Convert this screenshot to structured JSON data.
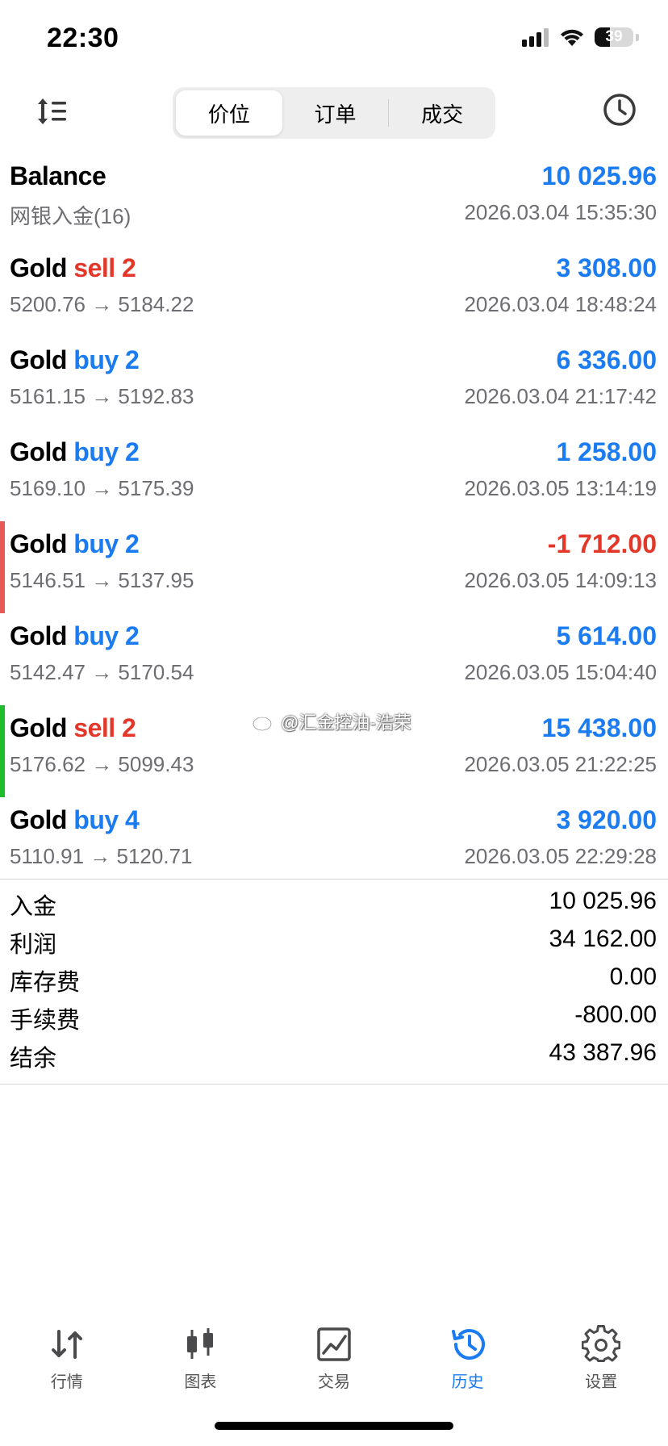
{
  "status": {
    "time": "22:30",
    "battery": "39",
    "battery_level": 0.39
  },
  "toolbar": {
    "segments": [
      {
        "label": "价位",
        "active": true
      },
      {
        "label": "订单",
        "active": false
      },
      {
        "label": "成交",
        "active": false
      }
    ]
  },
  "deals": [
    {
      "title": "Balance",
      "side": "",
      "sub": "网银入金(16)",
      "amount": "10 025.96",
      "amount_color": "#1b7cf2",
      "time": "2026.03.04 15:35:30",
      "indicator": ""
    },
    {
      "title": "Gold",
      "side": "sell 2",
      "side_type": "sell",
      "sub": "5200.76 → 5184.22",
      "amount": "3 308.00",
      "amount_color": "#1b7cf2",
      "time": "2026.03.04 18:48:24",
      "indicator": ""
    },
    {
      "title": "Gold",
      "side": "buy 2",
      "side_type": "buy",
      "sub": "5161.15 → 5192.83",
      "amount": "6 336.00",
      "amount_color": "#1b7cf2",
      "time": "2026.03.04 21:17:42",
      "indicator": ""
    },
    {
      "title": "Gold",
      "side": "buy 2",
      "side_type": "buy",
      "sub": "5169.10 → 5175.39",
      "amount": "1 258.00",
      "amount_color": "#1b7cf2",
      "time": "2026.03.05 13:14:19",
      "indicator": ""
    },
    {
      "title": "Gold",
      "side": "buy 2",
      "side_type": "buy",
      "sub": "5146.51 → 5137.95",
      "amount": "-1 712.00",
      "amount_color": "#e3372a",
      "time": "2026.03.05 14:09:13",
      "indicator": "#e55a55"
    },
    {
      "title": "Gold",
      "side": "buy 2",
      "side_type": "buy",
      "sub": "5142.47 → 5170.54",
      "amount": "5 614.00",
      "amount_color": "#1b7cf2",
      "time": "2026.03.05 15:04:40",
      "indicator": ""
    },
    {
      "title": "Gold",
      "side": "sell 2",
      "side_type": "sell",
      "sub": "5176.62 → 5099.43",
      "amount": "15 438.00",
      "amount_color": "#1b7cf2",
      "time": "2026.03.05 21:22:25",
      "indicator": "#1fbd2e"
    },
    {
      "title": "Gold",
      "side": "buy 4",
      "side_type": "buy",
      "sub": "5110.91 → 5120.71",
      "amount": "3 920.00",
      "amount_color": "#1b7cf2",
      "time": "2026.03.05 22:29:28",
      "indicator": ""
    }
  ],
  "watermark": "@汇金控油-浩荣",
  "summary": [
    {
      "label": "入金",
      "value": "10 025.96"
    },
    {
      "label": "利润",
      "value": "34 162.00"
    },
    {
      "label": "库存费",
      "value": "0.00"
    },
    {
      "label": "手续费",
      "value": "-800.00"
    },
    {
      "label": "结余",
      "value": "43 387.96"
    }
  ],
  "tabs": [
    {
      "label": "行情",
      "icon": "quotes-arrows-icon",
      "active": false
    },
    {
      "label": "图表",
      "icon": "candlestick-chart-icon",
      "active": false
    },
    {
      "label": "交易",
      "icon": "trade-line-chart-icon",
      "active": false
    },
    {
      "label": "历史",
      "icon": "history-clock-icon",
      "active": true
    },
    {
      "label": "设置",
      "icon": "gear-icon",
      "active": false
    }
  ],
  "colors": {
    "accent": "#1b7cf2",
    "sell": "#e3372a",
    "muted": "#6d6d72"
  }
}
